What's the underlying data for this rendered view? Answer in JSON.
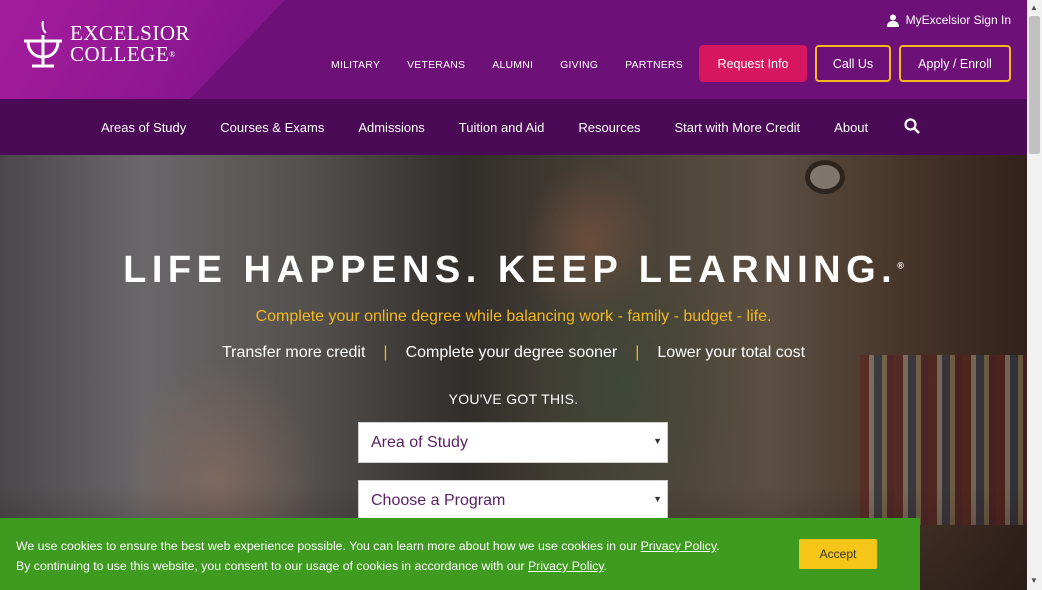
{
  "brand": {
    "line1": "Excelsior",
    "line2": "College",
    "reg": "®",
    "colors": {
      "purple": "#6d1179",
      "nav": "#4a0a55",
      "magenta": "#d6175f",
      "gold": "#f3b81b",
      "green": "#3e9b1f"
    }
  },
  "header": {
    "signin_label": "MyExcelsior Sign In",
    "utility_links": [
      "MILITARY",
      "VETERANS",
      "ALUMNI",
      "GIVING",
      "PARTNERS"
    ],
    "request_info": "Request Info",
    "call_us": "Call Us",
    "apply_enroll": "Apply / Enroll"
  },
  "nav": {
    "items": [
      "Areas of Study",
      "Courses & Exams",
      "Admissions",
      "Tuition and Aid",
      "Resources",
      "Start with More Credit",
      "About"
    ],
    "search_icon": "search-icon"
  },
  "hero": {
    "headline": "LIFE HAPPENS. KEEP LEARNING.",
    "headline_reg": "®",
    "subline": "Complete your online degree while balancing work - family - budget - life.",
    "benefits": [
      "Transfer more credit",
      "Complete your degree sooner",
      "Lower your total cost"
    ],
    "separator": "|",
    "gotthis": "YOU'VE GOT THIS.",
    "select_area": "Area of Study",
    "select_program": "Choose a Program"
  },
  "cookie": {
    "text1": "We use cookies to ensure the best web experience possible. You can learn more about how we use cookies in our ",
    "text2": "By continuing to use this website, you consent to our usage of cookies in accordance with our ",
    "link": "Privacy Policy",
    "period": ".",
    "accept": "Accept"
  }
}
